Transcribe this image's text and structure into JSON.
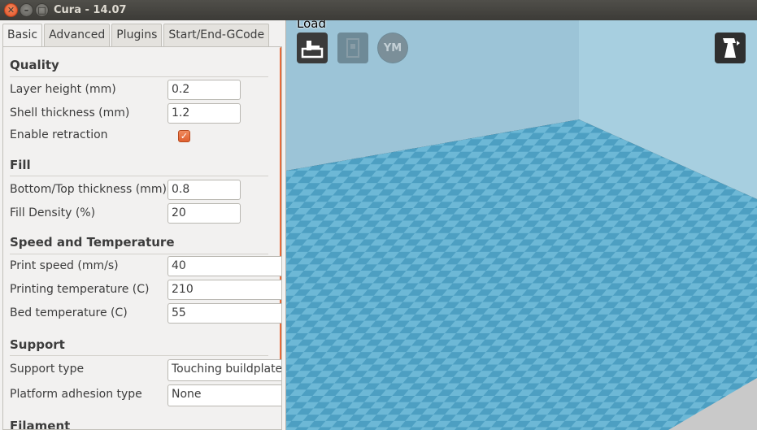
{
  "window": {
    "title": "Cura - 14.07",
    "close_glyph": "✕",
    "minimize_glyph": "–",
    "maximize_glyph": "□"
  },
  "tabs": [
    {
      "label": "Basic"
    },
    {
      "label": "Advanced"
    },
    {
      "label": "Plugins"
    },
    {
      "label": "Start/End-GCode"
    }
  ],
  "sections": {
    "quality": {
      "title": "Quality",
      "layer_height": {
        "label": "Layer height (mm)",
        "value": "0.2"
      },
      "shell_thickness": {
        "label": "Shell thickness (mm)",
        "value": "1.2"
      },
      "enable_retraction": {
        "label": "Enable retraction",
        "checked": true,
        "glyph": "✓"
      }
    },
    "fill": {
      "title": "Fill",
      "bottom_top_thickness": {
        "label": "Bottom/Top thickness (mm)",
        "value": "0.8"
      },
      "fill_density": {
        "label": "Fill Density (%)",
        "value": "20"
      }
    },
    "speed": {
      "title": "Speed and Temperature",
      "print_speed": {
        "label": "Print speed (mm/s)",
        "value": "40"
      },
      "printing_temp": {
        "label": "Printing temperature (C)",
        "value": "210"
      },
      "bed_temp": {
        "label": "Bed temperature (C)",
        "value": "55"
      }
    },
    "support": {
      "title": "Support",
      "support_type": {
        "label": "Support type",
        "value": "Touching buildplate"
      },
      "platform_adhesion": {
        "label": "Platform adhesion type",
        "value": "None"
      }
    },
    "filament": {
      "title": "Filament"
    }
  },
  "viewport": {
    "load_label": "Load",
    "ym_label": "YM",
    "icons": [
      "load-icon",
      "sd-card-icon",
      "youmagine-icon",
      "view-mode-icon"
    ],
    "colors": {
      "sky": "#a9cad9",
      "floor_light": "#6db8d6",
      "floor_dark": "#4d9fc2",
      "accent": "#e0602f"
    }
  }
}
